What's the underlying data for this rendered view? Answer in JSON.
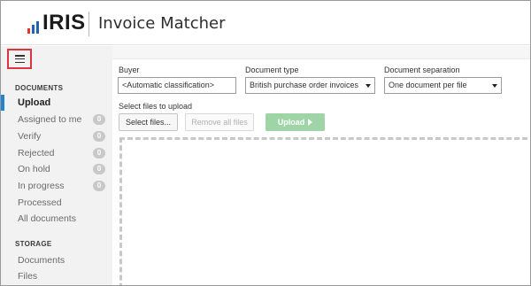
{
  "header": {
    "brand": "IRIS",
    "app_title": "Invoice Matcher"
  },
  "sidebar": {
    "menu_button_icon": "hamburger-menu-icon",
    "documents_title": "DOCUMENTS",
    "items": [
      {
        "label": "Upload",
        "active": true
      },
      {
        "label": "Assigned to me",
        "badge": "0"
      },
      {
        "label": "Verify",
        "badge": "0"
      },
      {
        "label": "Rejected",
        "badge": "0"
      },
      {
        "label": "On hold",
        "badge": "0"
      },
      {
        "label": "In progress",
        "badge": "0"
      },
      {
        "label": "Processed"
      },
      {
        "label": "All documents"
      }
    ],
    "storage_title": "STORAGE",
    "storage_items": [
      {
        "label": "Documents"
      },
      {
        "label": "Files"
      }
    ]
  },
  "form": {
    "buyer_label": "Buyer",
    "buyer_value": "<Automatic classification>",
    "doctype_label": "Document type",
    "doctype_value": "British purchase order invoices",
    "docsep_label": "Document separation",
    "docsep_value": "One document per file",
    "select_files_label": "Select files to upload",
    "select_files_button": "Select files...",
    "remove_all_button": "Remove all files",
    "upload_button": "Upload"
  },
  "colors": {
    "accent": "#1e86d0",
    "highlight_border": "#d9363e",
    "upload_button": "#9fd4a6",
    "logo_red": "#e4342b",
    "logo_blue": "#1e63b5"
  }
}
